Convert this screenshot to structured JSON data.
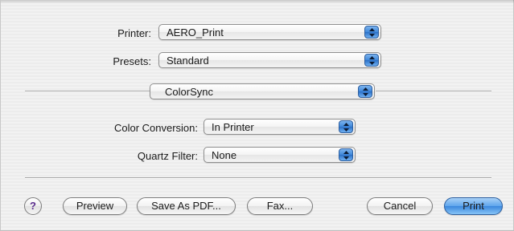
{
  "dialog": {
    "printer": {
      "label": "Printer:",
      "value": "AERO_Print"
    },
    "presets": {
      "label": "Presets:",
      "value": "Standard"
    },
    "panel": {
      "value": "ColorSync"
    },
    "color_conversion": {
      "label": "Color Conversion:",
      "value": "In Printer"
    },
    "quartz_filter": {
      "label": "Quartz Filter:",
      "value": "None"
    }
  },
  "buttons": {
    "help": "?",
    "preview": "Preview",
    "save_as_pdf": "Save As PDF...",
    "fax": "Fax...",
    "cancel": "Cancel",
    "print": "Print"
  },
  "colors": {
    "accent": "#3b87dd",
    "help_glyph": "#5b2d8e"
  },
  "icons": {
    "popup_stepper": "updown-arrows-icon"
  }
}
